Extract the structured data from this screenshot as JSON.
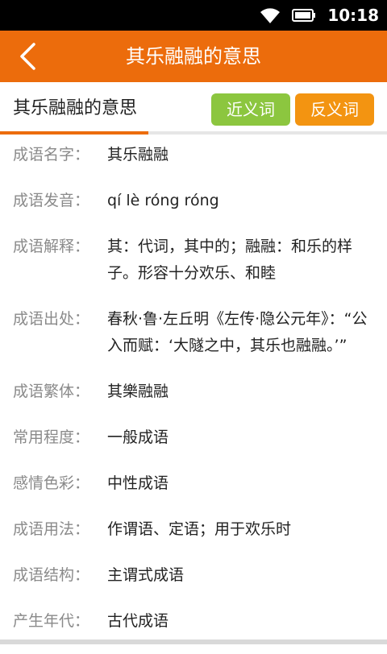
{
  "status_bar": {
    "time": "10:18",
    "icons": [
      "wifi-icon",
      "battery-icon"
    ]
  },
  "app_bar": {
    "title": "其乐融融的意思",
    "back_icon": "chevron-left-icon",
    "color": "#ec6c0c"
  },
  "subheader": {
    "title": "其乐融融的意思",
    "synonym_label": "近义词",
    "antonym_label": "反义词",
    "synonym_color": "#8cc63f",
    "antonym_color": "#f39411"
  },
  "rows": [
    {
      "label": "成语名字：",
      "value": "其乐融融"
    },
    {
      "label": "成语发音：",
      "value": "qí lè róng róng"
    },
    {
      "label": "成语解释：",
      "value": "其：代词，其中的；融融：和乐的样子。形容十分欢乐、和睦"
    },
    {
      "label": "成语出处：",
      "value": "春秋·鲁·左丘明《左传·隐公元年》：“公入而赋：‘大隧之中，其乐也融融。’”"
    },
    {
      "label": "成语繁体：",
      "value": "其樂融融"
    },
    {
      "label": "常用程度：",
      "value": "一般成语"
    },
    {
      "label": "感情色彩：",
      "value": "中性成语"
    },
    {
      "label": "成语用法：",
      "value": "作谓语、定语；用于欢乐时"
    },
    {
      "label": "成语结构：",
      "value": "主谓式成语"
    },
    {
      "label": "产生年代：",
      "value": "古代成语"
    }
  ]
}
